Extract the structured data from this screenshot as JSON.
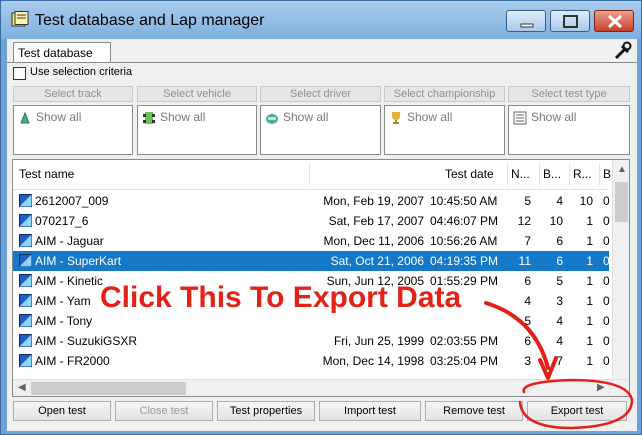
{
  "window": {
    "title": "Test database and Lap manager"
  },
  "tab": {
    "label": "Test database"
  },
  "selection": {
    "checkbox_label": "Use selection criteria",
    "checked": false
  },
  "filters": [
    {
      "button": "Select track",
      "value": "Show all",
      "icon": "track-icon"
    },
    {
      "button": "Select vehicle",
      "value": "Show all",
      "icon": "vehicle-icon"
    },
    {
      "button": "Select driver",
      "value": "Show all",
      "icon": "driver-helmet-icon"
    },
    {
      "button": "Select championship",
      "value": "Show all",
      "icon": "trophy-icon"
    },
    {
      "button": "Select test type",
      "value": "Show all",
      "icon": "test-type-icon"
    }
  ],
  "list": {
    "columns": [
      "Test name",
      "Test date",
      "N...",
      "B...",
      "R...",
      "B"
    ],
    "rows": [
      {
        "name": "2612007_009",
        "date": "Mon, Feb 19, 2007",
        "time": "10:45:50 AM",
        "n": "5",
        "b": "4",
        "r": "10",
        "b2": "0"
      },
      {
        "name": "070217_6",
        "date": "Sat, Feb 17, 2007",
        "time": "04:46:07 PM",
        "n": "12",
        "b": "10",
        "r": "1",
        "b2": "0"
      },
      {
        "name": "AIM - Jaguar",
        "date": "Mon, Dec 11, 2006",
        "time": "10:56:26 AM",
        "n": "7",
        "b": "6",
        "r": "1",
        "b2": "0"
      },
      {
        "name": "AIM - SuperKart",
        "date": "Sat, Oct 21, 2006",
        "time": "04:19:35 PM",
        "n": "11",
        "b": "6",
        "r": "1",
        "b2": "0",
        "selected": true
      },
      {
        "name": "AIM - Kinetic",
        "date": "Sun, Jun 12, 2005",
        "time": "01:55:29 PM",
        "n": "6",
        "b": "5",
        "r": "1",
        "b2": "0"
      },
      {
        "name": "AIM - Yam",
        "date": "",
        "time": "",
        "n": "4",
        "b": "3",
        "r": "1",
        "b2": "0"
      },
      {
        "name": "AIM - Tony",
        "date": "",
        "time": "",
        "n": "5",
        "b": "4",
        "r": "1",
        "b2": "0"
      },
      {
        "name": "AIM - SuzukiGSXR",
        "date": "Fri, Jun 25, 1999",
        "time": "02:03:55 PM",
        "n": "6",
        "b": "4",
        "r": "1",
        "b2": "0"
      },
      {
        "name": "AIM - FR2000",
        "date": "Mon, Dec 14, 1998",
        "time": "03:25:04 PM",
        "n": "3",
        "b": "7",
        "r": "1",
        "b2": "0"
      }
    ]
  },
  "buttons": {
    "open": "Open test",
    "close": "Close test",
    "properties": "Test properties",
    "import": "Import test",
    "remove": "Remove test",
    "export": "Export test"
  },
  "annotation": {
    "text": "Click This To Export Data",
    "color": "#e32117"
  },
  "colors": {
    "selection": "#1679c8",
    "titlebar": "#7fb0e0"
  }
}
